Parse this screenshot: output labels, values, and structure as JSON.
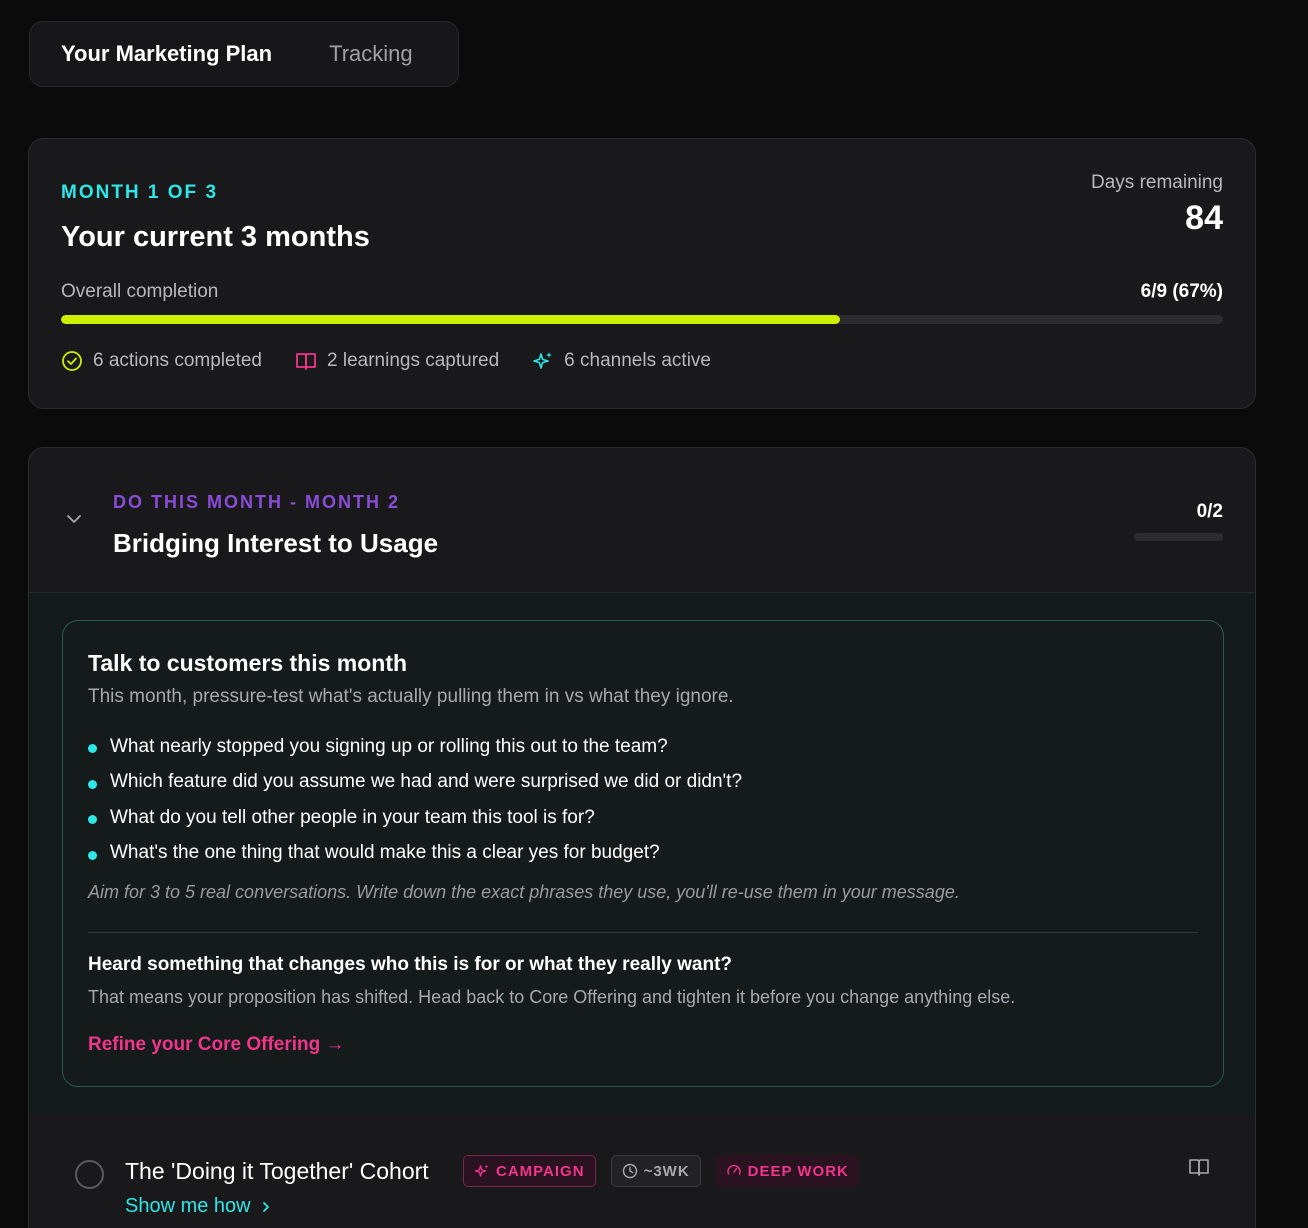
{
  "tabs": [
    {
      "label": "Your Marketing Plan",
      "active": true
    },
    {
      "label": "Tracking",
      "active": false
    }
  ],
  "overview": {
    "kicker": "MONTH 1 OF 3",
    "title": "Your current 3 months",
    "days_label": "Days remaining",
    "days_value": "84",
    "completion_label": "Overall completion",
    "completion_value": "6/9 (67%)",
    "completion_fraction": 0.67,
    "stats": [
      {
        "icon": "check-circle-icon",
        "label": "6 actions completed",
        "color": "#cdf000"
      },
      {
        "icon": "book-icon",
        "label": "2 learnings captured",
        "color": "#f0358a"
      },
      {
        "icon": "sparkles-icon",
        "label": "6 channels active",
        "color": "#2ee6e6"
      }
    ]
  },
  "month": {
    "kicker": "DO THIS MONTH - MONTH 2",
    "title": "Bridging Interest to Usage",
    "count": "0/2",
    "progress_fraction": 0,
    "talk": {
      "title": "Talk to customers this month",
      "subtitle": "This month, pressure-test what's actually pulling them in vs what they ignore.",
      "questions": [
        "What nearly stopped you signing up or rolling this out to the team?",
        "Which feature did you assume we had and were surprised we did or didn't?",
        "What do you tell other people in your team this tool is for?",
        "What's the one thing that would make this a clear yes for budget?"
      ],
      "note": "Aim for 3 to 5 real conversations. Write down the exact phrases they use, you'll re-use them in your message.",
      "heard_title": "Heard something that changes who this is for or what they really want?",
      "heard_sub": "That means your proposition has shifted. Head back to Core Offering and tighten it before you change anything else.",
      "link": "Refine your Core Offering →"
    },
    "action": {
      "title": "The 'Doing it Together' Cohort",
      "badges": [
        {
          "icon": "sparkles-icon",
          "label": "CAMPAIGN"
        },
        {
          "icon": "clock-icon",
          "label": "~3WK"
        },
        {
          "icon": "gauge-icon",
          "label": "DEEP WORK"
        }
      ],
      "show_how": "Show me how"
    }
  },
  "colors": {
    "background": "#0b0b0c",
    "card": "#19191b",
    "accent_cyan": "#2ee6e6",
    "accent_lime": "#cdf000",
    "accent_pink": "#f0358a",
    "accent_purple": "#8a4bd6"
  }
}
